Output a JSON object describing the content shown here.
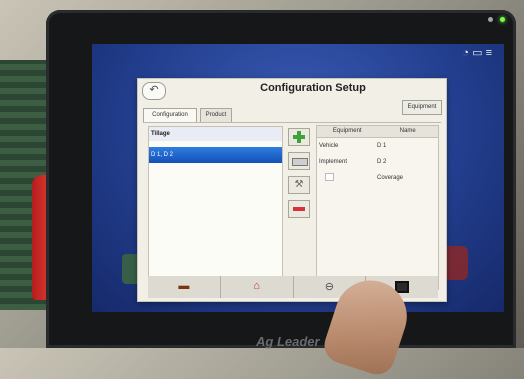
{
  "dialog": {
    "title": "Configuration Setup",
    "equipment_button": "Equipment",
    "tabs": [
      "Configuration",
      "Product"
    ],
    "list": {
      "header": "Tillage",
      "selected_item": "D 1, D 2"
    },
    "details": {
      "columns": [
        "Equipment",
        "Name"
      ],
      "rows": [
        {
          "label": "Vehicle",
          "value": "D 1"
        },
        {
          "label": "Implement",
          "value": "D 2"
        },
        {
          "label": "",
          "value": "Coverage"
        }
      ]
    }
  },
  "tools": {
    "add_icon": "plus-icon",
    "edit_icon": "edit-icon",
    "wrench_icon": "wrench-icon",
    "remove_icon": "minus-icon"
  },
  "taskbar": {
    "items": [
      "tractor-icon",
      "barn-icon",
      "guidance-icon",
      "display-icon"
    ]
  },
  "device": {
    "brand": "Ag Leader"
  },
  "colors": {
    "screen_blue": "#233f8f",
    "selected_row": "#1f63cc",
    "add_green": "#3ea43a",
    "remove_red": "#d8323a"
  }
}
